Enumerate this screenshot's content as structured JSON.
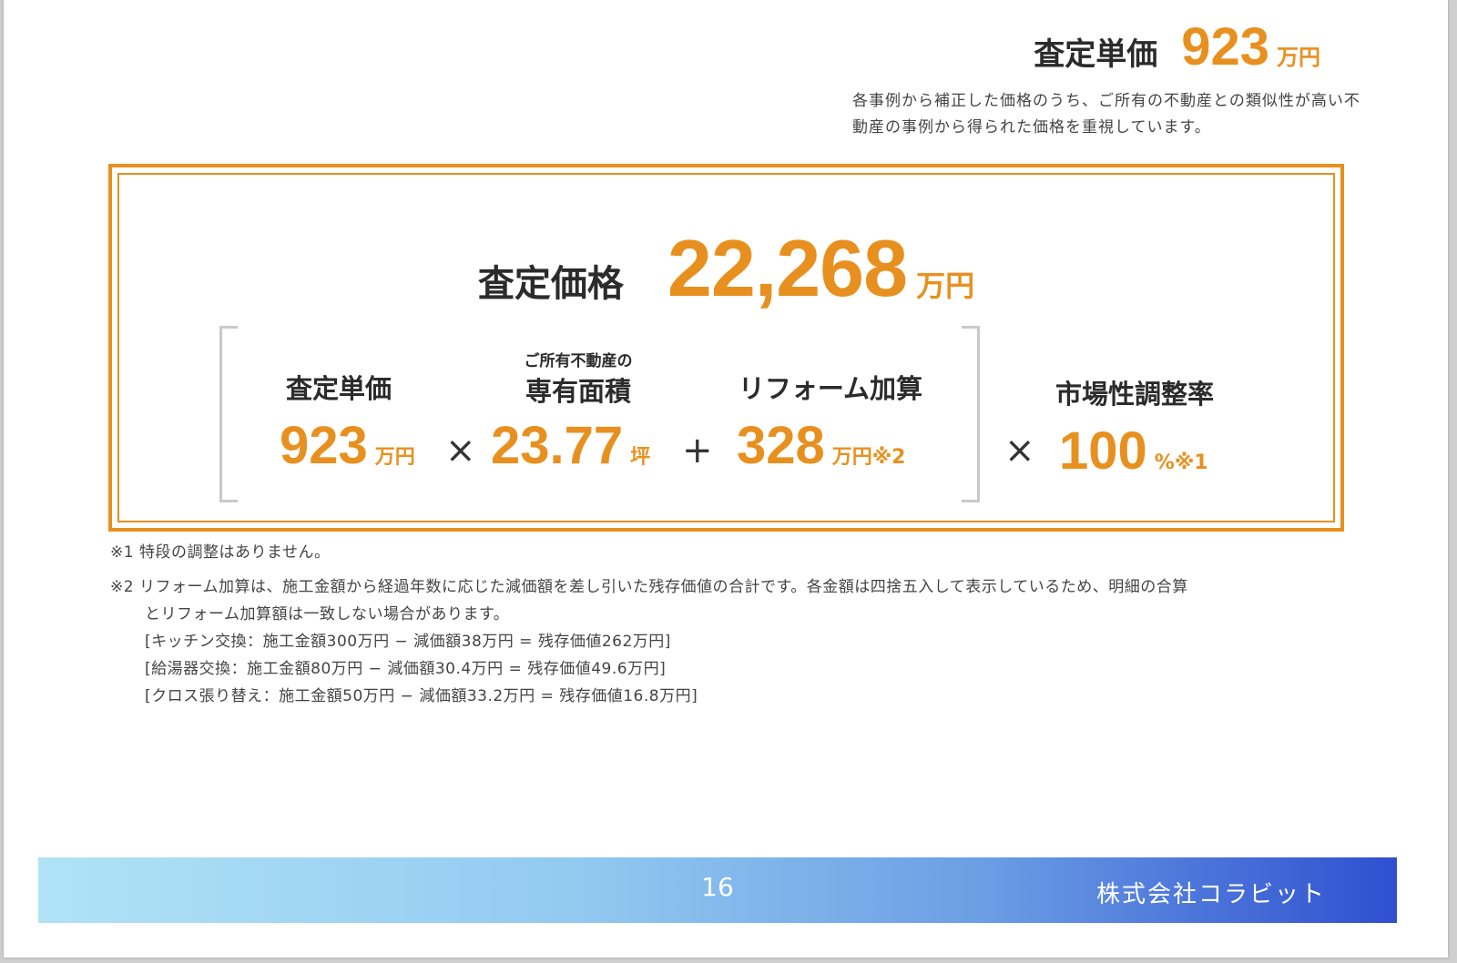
{
  "unit_price": {
    "label": "査定単価",
    "value": "923",
    "unit": "万円",
    "note": "各事例から補正した価格のうち、ご所有の不動産との類似性が高い不動産の事例から得られた価格を重視しています。"
  },
  "assessment": {
    "label": "査定価格",
    "value": "22,268",
    "unit": "万円"
  },
  "formula": {
    "unit_price": {
      "label": "査定単価",
      "value": "923",
      "unit": "万円"
    },
    "area": {
      "sub_label": "ご所有不動産の",
      "label": "専有面積",
      "value": "23.77",
      "unit": "坪"
    },
    "reform": {
      "label": "リフォーム加算",
      "value": "328",
      "unit": "万円※2"
    },
    "market": {
      "label": "市場性調整率",
      "value": "100",
      "unit": "%※1"
    },
    "op_times": "×",
    "op_plus": "+"
  },
  "notes": {
    "note1": "※1 特段の調整はありません。",
    "note2_line1": "※2 リフォーム加算は、施工金額から経過年数に応じた減価額を差し引いた残存価値の合計です。各金額は四捨五入して表示しているため、明細の合算",
    "note2_line2": "とリフォーム加算額は一致しない場合があります。",
    "details": [
      "[キッチン交換：施工金額300万円 − 減価額38万円 = 残存価値262万円]",
      "[給湯器交換：施工金額80万円 − 減価額30.4万円 = 残存価値49.6万円]",
      "[クロス張り替え：施工金額50万円 − 減価額33.2万円 = 残存価値16.8万円]"
    ]
  },
  "footer": {
    "page_number": "16",
    "company": "株式会社コラビット"
  },
  "colors": {
    "accent": "#e8901f",
    "footer_start": "#b0e3f6",
    "footer_end": "#2f4fd0"
  }
}
